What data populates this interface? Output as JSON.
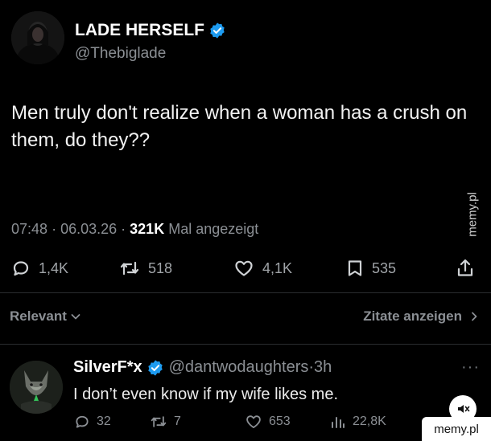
{
  "tweet": {
    "author_name": "LADE HERSELF",
    "author_handle": "@Thebiglade",
    "text": "Men truly don't realize when a woman has a crush on them, do they??",
    "time": "07:48",
    "date": "06.03.26",
    "views_count": "321K",
    "views_label": "Mal angezeigt",
    "replies": "1,4K",
    "retweets": "518",
    "likes": "4,1K",
    "bookmarks": "535"
  },
  "filters": {
    "sort_label": "Relevant",
    "quotes_label": "Zitate anzeigen"
  },
  "reply": {
    "name": "SilverF*x",
    "handle": "@dantwodaughters",
    "time": "3h",
    "text": "I don’t even know if my wife likes me.",
    "replies": "32",
    "retweets": "7",
    "likes": "653",
    "views": "22,8K"
  },
  "watermark": {
    "side": "memy.pl",
    "badge": "memy.pl"
  },
  "colors": {
    "background": "#000000",
    "verified": "#1d9bf0",
    "muted_text": "#8b8f94"
  },
  "icons": [
    "verified-badge-icon",
    "reply-icon",
    "retweet-icon",
    "like-icon",
    "bookmark-icon",
    "share-icon",
    "chevron-down-icon",
    "chevron-right-icon",
    "more-icon",
    "views-icon",
    "sound-icon"
  ]
}
